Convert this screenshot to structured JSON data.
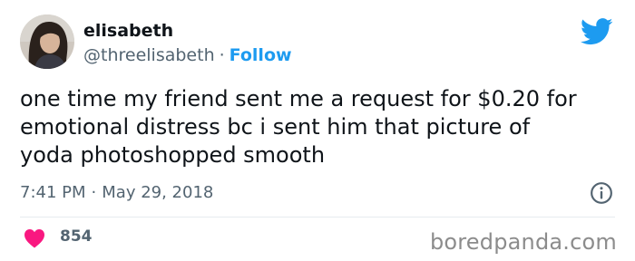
{
  "author": {
    "name": "elisabeth",
    "handle": "@threelisabeth",
    "separator": "·",
    "follow_label": "Follow",
    "avatar_icon": "user-avatar-photo"
  },
  "logo_icon": "twitter-bird-icon",
  "tweet": {
    "lines": [
      "one time my friend sent me a request for $0.20 for",
      "emotional distress bc i sent him that picture of",
      "yoda photoshopped smooth"
    ]
  },
  "meta": {
    "time": "7:41 PM",
    "separator": "·",
    "date": "May 29, 2018",
    "info_icon": "info-circle-icon"
  },
  "engagement": {
    "like_icon": "heart-icon",
    "like_count": "854"
  },
  "watermark": "boredpanda.com",
  "colors": {
    "accent": "#1d9bf0",
    "heart": "#f91880",
    "secondary_text": "#536471",
    "divider": "#e6ecf0"
  }
}
